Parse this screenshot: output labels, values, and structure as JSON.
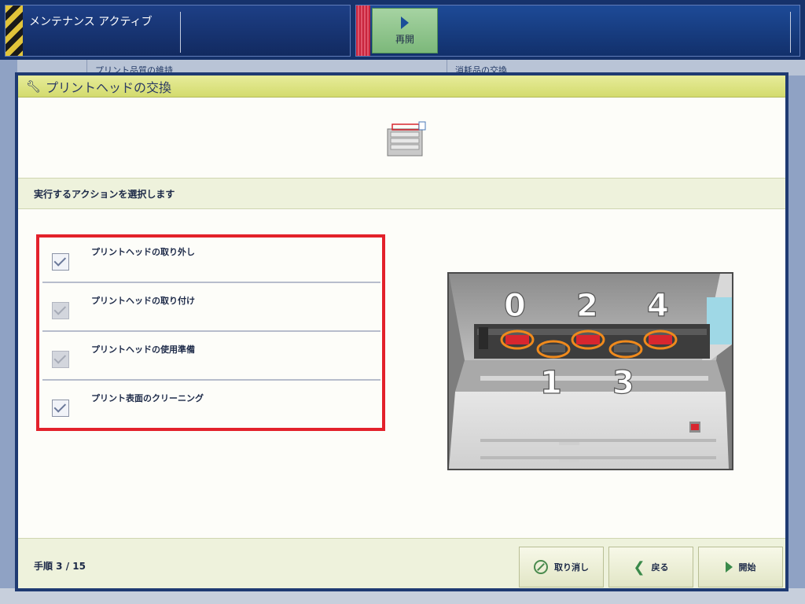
{
  "status_bar": {
    "mode_text": "メンテナンス アクティブ",
    "resume_label": "再開"
  },
  "background_tabs": {
    "tab1": "プリント品質の維持",
    "tab2": "消耗品の交換"
  },
  "dialog": {
    "title": "プリントヘッドの交換",
    "instruction": "実行するアクションを選択します",
    "actions": [
      {
        "label": "プリントヘッドの取り外し",
        "checked": true,
        "enabled": true
      },
      {
        "label": "プリントヘッドの取り付け",
        "checked": true,
        "enabled": false
      },
      {
        "label": "プリントヘッドの使用準備",
        "checked": true,
        "enabled": false
      },
      {
        "label": "プリント表面のクリーニング",
        "checked": true,
        "enabled": true
      }
    ],
    "illustration_labels": [
      "0",
      "1",
      "2",
      "3",
      "4"
    ],
    "step": "手順 3 / 15",
    "buttons": {
      "cancel": "取り消し",
      "back": "戻る",
      "start": "開始"
    }
  },
  "colors": {
    "highlight_border": "#e3212b",
    "title_bar": "#d3db6e",
    "slot_ring": "#f08a1c",
    "accent_green": "#3a8a4a"
  },
  "icons": {
    "title": "wrench-icon",
    "cancel": "cancel-icon",
    "back": "chevron-left-icon",
    "start": "play-icon",
    "resume": "play-icon"
  }
}
